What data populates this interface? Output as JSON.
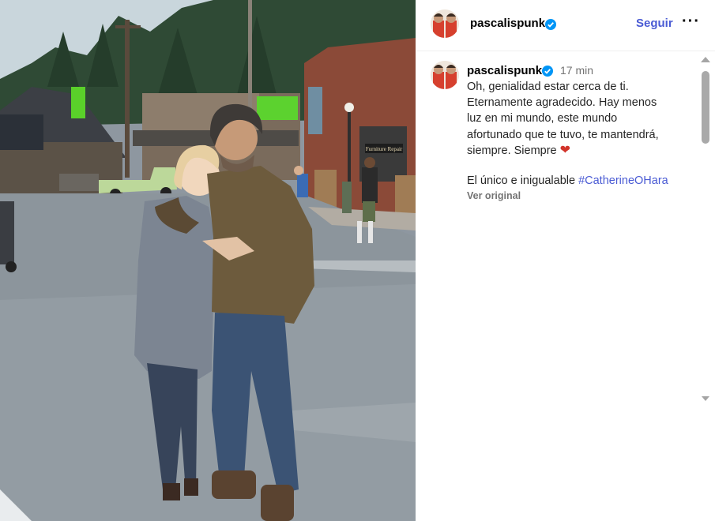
{
  "post": {
    "photo_alt": "Two people embracing on a film set street",
    "username": "pascalispunk",
    "follow_label": "Seguir",
    "more_label": "···",
    "time": "17 min",
    "caption": "Oh, genialidad estar cerca de ti.\nEternamente agradecido. Hay menos\nluz en mi mundo, este mundo\nafortunado que te tuvo, te mantendrá,\nsiempre. Siempre",
    "caption_emoji": "❤",
    "second_line_prefix": "El único e inigualable ",
    "hashtag": "#CatherineOHara",
    "see_original": "Ver original",
    "sign_text": "Furniture Repair"
  },
  "colors": {
    "link": "#4a5bd4",
    "secondary_text": "#737373",
    "verified": "#0095f6",
    "heart": "#d2342b"
  },
  "icons": {
    "verified": "verified-badge-icon",
    "more": "more-options-icon",
    "heart": "red-heart-emoji"
  }
}
